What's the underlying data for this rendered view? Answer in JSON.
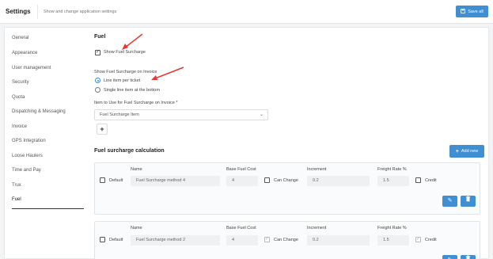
{
  "header": {
    "title": "Settings",
    "subtitle": "Show and change application settings",
    "save_label": "Save all"
  },
  "sidebar": {
    "items": [
      {
        "label": "General"
      },
      {
        "label": "Appearance"
      },
      {
        "label": "User management"
      },
      {
        "label": "Security"
      },
      {
        "label": "Quota"
      },
      {
        "label": "Dispatching & Messaging"
      },
      {
        "label": "Invoice"
      },
      {
        "label": "GPS Integration"
      },
      {
        "label": "Loose Haulers"
      },
      {
        "label": "Time and Pay"
      },
      {
        "label": "Trux"
      },
      {
        "label": "Fuel"
      }
    ],
    "active": "Fuel"
  },
  "fuel": {
    "title": "Fuel",
    "show_surcharge_label": "Show Fuel Surcharge",
    "show_surcharge_checked": true,
    "on_invoice_label": "Show Fuel Surcharge on Invoice",
    "options": [
      {
        "label": "Line item per ticket",
        "selected": true
      },
      {
        "label": "Single line item at the bottom",
        "selected": false
      }
    ],
    "item_label": "Item to Use for Fuel Surcharge on Invoice *",
    "item_value": "Fuel Surcharge Item",
    "add_item_symbol": "+"
  },
  "calculation": {
    "title": "Fuel surcharge calculation",
    "add_new_label": "Add new",
    "headers": {
      "name": "Name",
      "base_fuel_cost": "Base Fuel Cost",
      "increment": "Increment",
      "freight_rate": "Freight Rate %"
    },
    "default_label": "Default",
    "can_change_label": "Can Change",
    "credit_label": "Credit",
    "methods": [
      {
        "name": "Fuel Surcharge method 4",
        "base_fuel_cost": "4",
        "increment": "0.2",
        "freight_rate": "1.5",
        "default": false,
        "can_change": false,
        "credit": false
      },
      {
        "name": "Fuel Surcharge method 2",
        "base_fuel_cost": "4",
        "increment": "0.2",
        "freight_rate": "1.5",
        "default": false,
        "can_change": true,
        "credit": true
      }
    ]
  },
  "colors": {
    "accent": "#3f8fd2",
    "annotation_arrow": "#e53935"
  },
  "icons": {
    "edit": "edit-icon",
    "delete": "trash-icon",
    "add": "plus-icon",
    "save": "save-icon",
    "dropdown": "chevron-down-icon"
  }
}
